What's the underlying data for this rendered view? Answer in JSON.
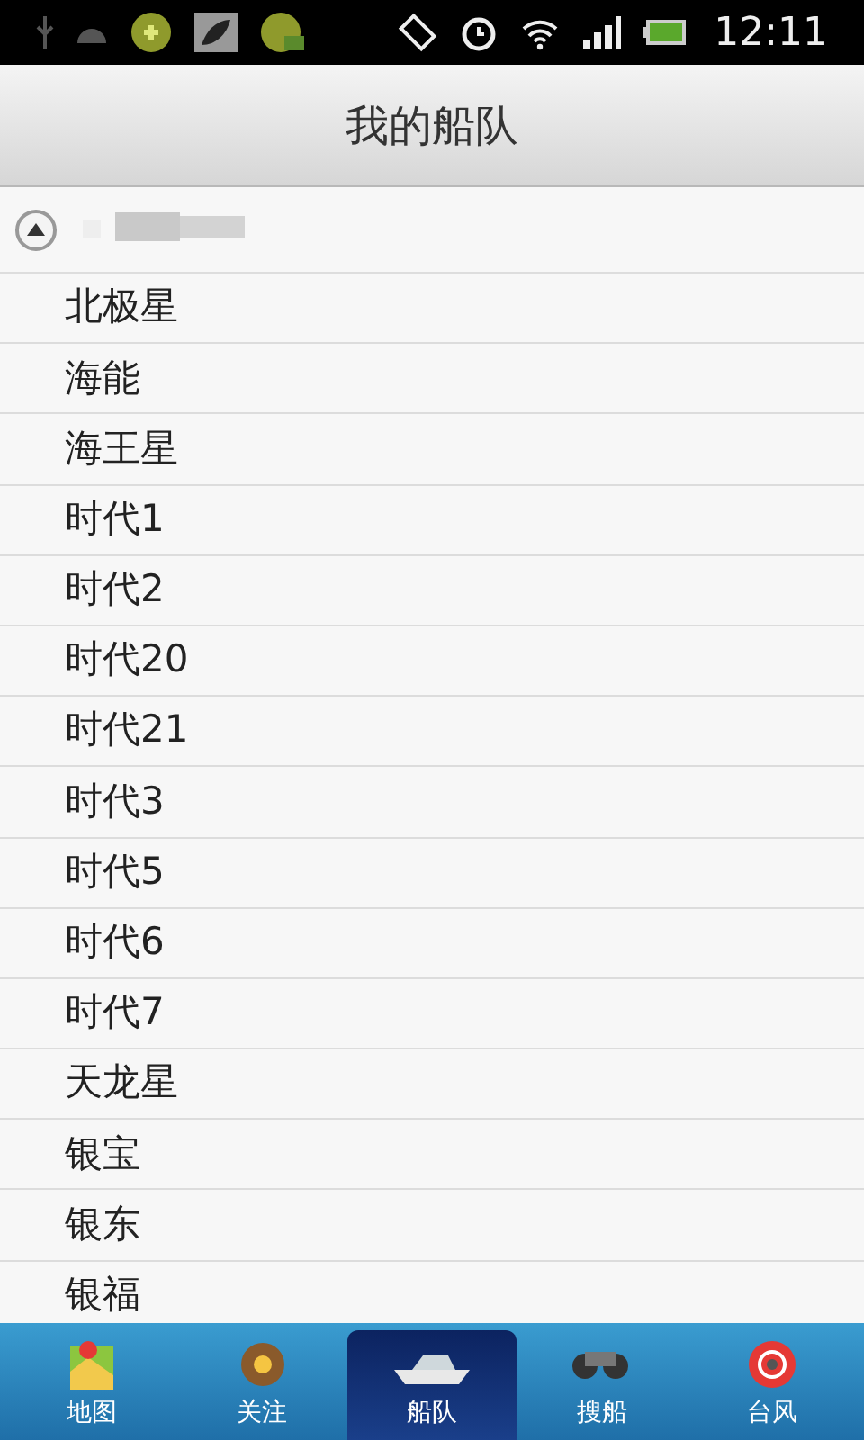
{
  "status_bar": {
    "time": "12:11"
  },
  "title": "我的船队",
  "group": {
    "expanded": true
  },
  "ships": [
    "北极星",
    "海能",
    "海王星",
    "时代1",
    "时代2",
    "时代20",
    "时代21",
    "时代3",
    "时代5",
    "时代6",
    "时代7",
    "天龙星",
    "银宝",
    "银东",
    "银福"
  ],
  "tabs": [
    {
      "label": "地图",
      "selected": false
    },
    {
      "label": "关注",
      "selected": false
    },
    {
      "label": "船队",
      "selected": true
    },
    {
      "label": "搜船",
      "selected": false
    },
    {
      "label": "台风",
      "selected": false
    }
  ]
}
